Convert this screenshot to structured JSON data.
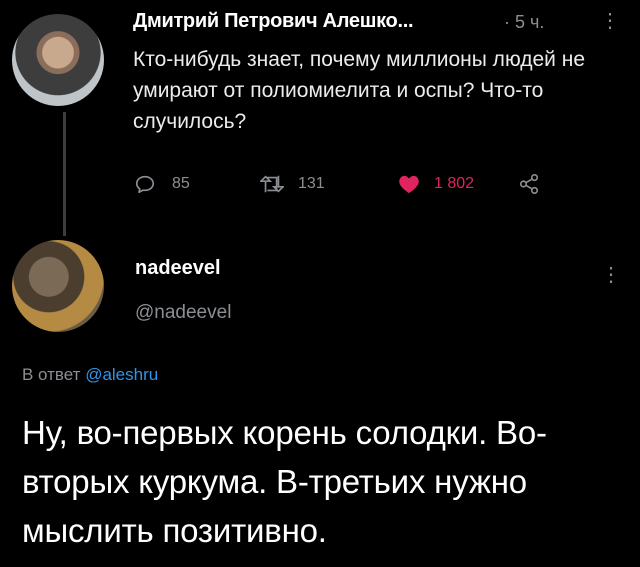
{
  "tweet": {
    "author_name": "Дмитрий Петрович Алешко...",
    "time": "· 5 ч.",
    "more": "⋮",
    "text": "Кто-нибудь знает, почему миллионы людей не умирают от полиомиелита и оспы? Что-то случилось?",
    "replies": "85",
    "retweets": "131",
    "likes": "1 802"
  },
  "reply": {
    "author_name": "nadeevel",
    "handle": "@nadeevel",
    "more": "⋮",
    "reply_prefix": "В ответ",
    "reply_to": "@aleshru",
    "text": "Ну, во-первых корень солодки. Во-вторых куркума. В-третьих нужно мыслить позитивно."
  },
  "colors": {
    "background": "#000000",
    "muted": "#8b8f93",
    "link": "#2f95e8",
    "like": "#e0245e"
  },
  "icons": [
    "reply-icon",
    "retweet-icon",
    "like-icon",
    "share-icon",
    "more-icon"
  ]
}
